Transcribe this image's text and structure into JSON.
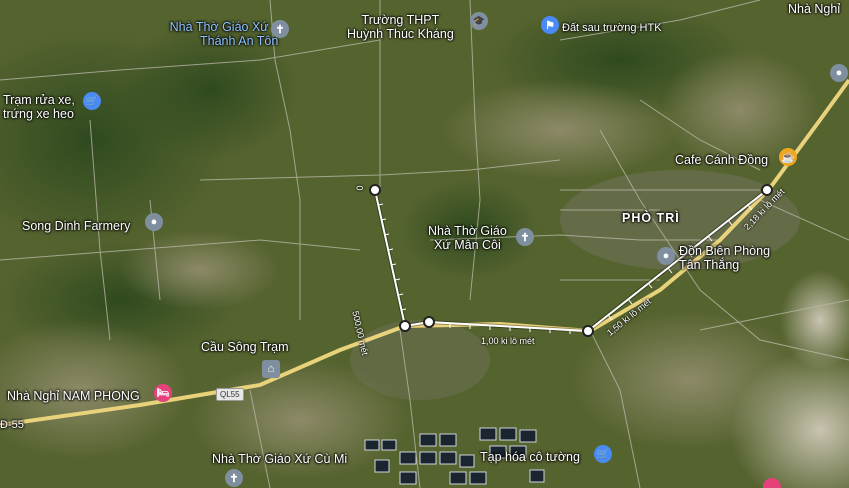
{
  "map": {
    "labels": [
      {
        "id": "church-thanh-an-ton",
        "text1": "Nhà Thờ Giáo Xứ",
        "text2": "Thánh An Tôn"
      },
      {
        "id": "school-htk",
        "text1": "Trường THPT",
        "text2": "Huỳnh Thúc Kháng"
      },
      {
        "id": "dat-sau-truong",
        "text1": "Đất sau trường HTK"
      },
      {
        "id": "nha-nghi-top",
        "text1": "Nhà Nghỉ"
      },
      {
        "id": "tram-rua-xe",
        "text1": "Trạm rửa xe,",
        "text2": "trứng xe heo"
      },
      {
        "id": "cafe-canh-dong",
        "text1": "Cafe Cánh Đồng"
      },
      {
        "id": "song-dinh-farmery",
        "text1": "Song Dinh Farmery"
      },
      {
        "id": "pho-tri",
        "text1": "PHÒ TRÌ"
      },
      {
        "id": "church-man-coi",
        "text1": "Nhà Thờ Giáo",
        "text2": "Xứ Mân Côi"
      },
      {
        "id": "don-bien-phong",
        "text1": "Đồn Biên Phòng",
        "text2": "Tân Thắng"
      },
      {
        "id": "cau-song-tram",
        "text1": "Cầu Sông Trạm"
      },
      {
        "id": "nha-nghi-nam-phong",
        "text1": "Nhà Nghỉ NAM PHONG"
      },
      {
        "id": "church-cu-mi",
        "text1": "Nhà Thờ Giáo Xứ Cù Mi"
      },
      {
        "id": "tap-hoa",
        "text1": "Tạp hóa cô tường"
      }
    ],
    "road_shields": {
      "ql55": "QL55",
      "dt55": "Đ-55"
    },
    "measurement": {
      "start_label": "0",
      "segments": [
        "500,00 mét",
        "1,00 ki lô mét",
        "1,50 ki lô mét",
        "2,18 ki lô mét"
      ]
    },
    "icons": {
      "church": "cross-icon",
      "school": "graduation-cap-icon",
      "flag": "flag-icon",
      "shop": "shopping-cart-icon",
      "cafe": "coffee-cup-icon",
      "bed": "bed-icon",
      "generic": "location-pin-icon"
    },
    "colors": {
      "highway": "#e9d27c",
      "poi_blue": "#4a8af4",
      "poi_grey": "#7f8fa0",
      "poi_orange": "#f2a51e",
      "poi_pink": "#e5427c",
      "church_text": "#8fc3ff"
    }
  }
}
